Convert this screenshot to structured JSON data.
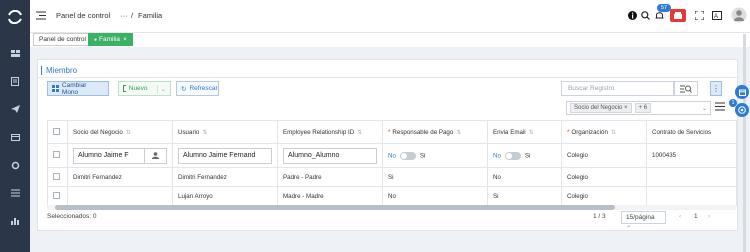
{
  "header": {
    "breadcrumb_root": "Panel de control",
    "breadcrumb_more": "···",
    "breadcrumb_sep": "/",
    "breadcrumb_current": "Familia",
    "notification_count": "57"
  },
  "tabs": [
    {
      "label": "Panel de control"
    },
    {
      "label": "Familia"
    }
  ],
  "tab_close": "×",
  "section": {
    "title": "Miembro"
  },
  "toolbar": {
    "change_mono": "Cambiar Mono",
    "new": "Nuevo",
    "refresh": "Refrescar",
    "search_placeholder": "Buscar Registro",
    "more": "⋮"
  },
  "filter": {
    "chip": "Socio del Negocio",
    "chip_close": "×",
    "more": "+ 6"
  },
  "table": {
    "headers": [
      {
        "label": "Socio del Negocio",
        "required": false
      },
      {
        "label": "Usuario",
        "required": false
      },
      {
        "label": "Employee Relationship ID",
        "required": false
      },
      {
        "label": "Responsable de Pago",
        "required": true
      },
      {
        "label": "Envia Email",
        "required": false
      },
      {
        "label": "Organización",
        "required": true
      },
      {
        "label": "Contrato de Servicios",
        "required": false
      }
    ],
    "edit_row": {
      "socio": "Alumno Jaime F",
      "usuario": "Alumno Jaime Fernand",
      "relacion": "Alumno_Alumno",
      "resp_no": "No",
      "resp_si": "Si",
      "email_no": "No",
      "email_si": "Si",
      "organizacion": "Colegio",
      "contrato": "1000435"
    },
    "rows": [
      {
        "socio": "Dimitri Fernandez",
        "usuario": "Dimitri Fernandez",
        "relacion": "Padre - Padre",
        "resp": "Si",
        "email": "No",
        "organizacion": "Colegio",
        "contrato": ""
      },
      {
        "socio": "",
        "usuario": "Lujan Arroyo",
        "relacion": "Madre - Madre",
        "resp": "No",
        "email": "Si",
        "organizacion": "Colegio",
        "contrato": ""
      }
    ]
  },
  "footer": {
    "selected": "Seleccionados: 0",
    "pages": "1 / 3",
    "page_size": "15/página",
    "current_page": "1",
    "prev": "‹",
    "next": "›"
  },
  "floating": {
    "badge": "1"
  },
  "colors": {
    "accent": "#2d7bd6",
    "success": "#3bb166",
    "danger": "#e53935",
    "rail": "#2b3648"
  }
}
